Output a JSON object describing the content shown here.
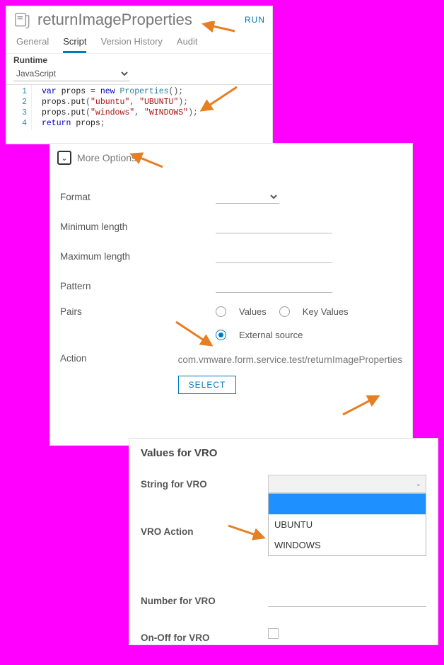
{
  "panel1": {
    "title": "returnImageProperties",
    "run": "RUN",
    "tabs": {
      "general": "General",
      "script": "Script",
      "version": "Version History",
      "audit": "Audit"
    },
    "runtime_label": "Runtime",
    "runtime_value": "JavaScript",
    "code_lines": [
      "1",
      "2",
      "3",
      "4"
    ]
  },
  "panel2": {
    "more": "More Options",
    "format": "Format",
    "minlen": "Minimum length",
    "maxlen": "Maximum length",
    "pattern": "Pattern",
    "pairs": "Pairs",
    "radio_values": "Values",
    "radio_keyvalues": "Key Values",
    "radio_external": "External source",
    "action": "Action",
    "action_value": "com.vmware.form.service.test/returnImageProperties",
    "select": "SELECT"
  },
  "panel3": {
    "title": "Values for VRO",
    "string_label": "String for VRO",
    "vro_action": "VRO Action",
    "option_ubuntu": "UBUNTU",
    "option_windows": "WINDOWS",
    "number_label": "Number for VRO",
    "onoff_label": "On-Off for VRO"
  }
}
